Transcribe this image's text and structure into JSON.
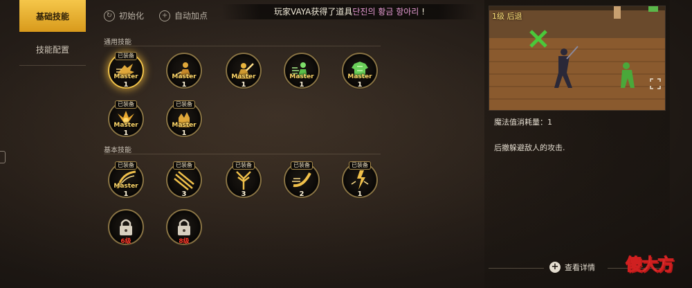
{
  "nav": {
    "tabs": [
      {
        "label": "基础技能",
        "active": true
      },
      {
        "label": "技能配置",
        "active": false
      }
    ]
  },
  "toolbar": {
    "reset_label": "初始化",
    "auto_label": "自动加点"
  },
  "notice": {
    "prefix": "玩家VAYA获得了道具",
    "item": "단진의 황금 항아리",
    "suffix": "!"
  },
  "sections": {
    "common": "通用技能",
    "basic": "基本技能"
  },
  "common_skills": [
    {
      "equipped": "已装备",
      "master": "Master",
      "level": "1",
      "icon": "rush-icon",
      "selected": true
    },
    {
      "equipped": "",
      "master": "Master",
      "level": "1",
      "icon": "crouch-icon"
    },
    {
      "equipped": "",
      "master": "Master",
      "level": "1",
      "icon": "strike-icon"
    },
    {
      "equipped": "",
      "master": "Master",
      "level": "1",
      "icon": "green-dash-icon"
    },
    {
      "equipped": "",
      "master": "Master",
      "level": "1",
      "icon": "green-armor-icon"
    },
    {
      "equipped": "已装备",
      "master": "Master",
      "level": "1",
      "icon": "flame-wings-icon"
    },
    {
      "equipped": "已装备",
      "master": "Master",
      "level": "1",
      "icon": "hand-block-icon"
    }
  ],
  "basic_skills": [
    {
      "equipped": "已装备",
      "master": "Master",
      "level": "1",
      "icon": "slash-arc-icon"
    },
    {
      "equipped": "已装备",
      "master": "",
      "level": "3",
      "icon": "multi-slash-icon"
    },
    {
      "equipped": "已装备",
      "master": "",
      "level": "3",
      "icon": "uppercut-icon"
    },
    {
      "equipped": "已装备",
      "master": "",
      "level": "2",
      "icon": "crescent-wave-icon"
    },
    {
      "equipped": "已装备",
      "master": "",
      "level": "1",
      "icon": "lightning-burst-icon"
    },
    {
      "locked": true,
      "unlock": "6级",
      "icon": "locked-skill-icon"
    },
    {
      "locked": true,
      "unlock": "8级",
      "icon": "locked-skill-icon"
    }
  ],
  "detail": {
    "preview_label": "1级 后退",
    "mp_cost": "魔法值消耗量：1",
    "description": "后撤躲避敌人的攻击.",
    "view_details": "查看详情"
  },
  "watermark": {
    "text1": "傻",
    "text2": "大方"
  }
}
